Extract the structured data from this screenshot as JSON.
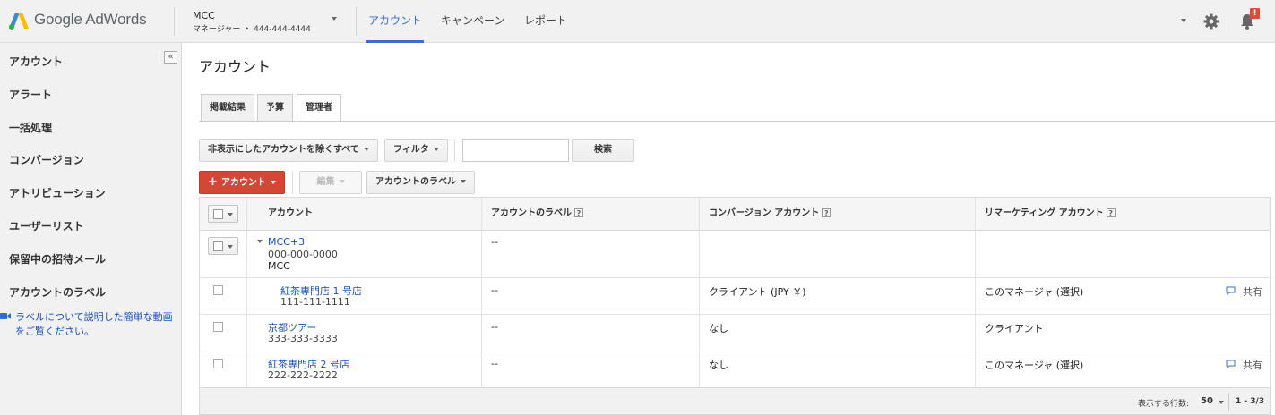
{
  "header": {
    "product": "Google AdWords",
    "account_name": "MCC",
    "account_sub": "マネージャー ・ 444-444-4444",
    "tabs": [
      {
        "label": "アカウント"
      },
      {
        "label": "キャンペーン"
      },
      {
        "label": "レポート"
      }
    ],
    "notification_badge": "!",
    "icons": [
      "adwords-logo-icon",
      "chevron-down-icon",
      "gear-icon",
      "bell-icon"
    ]
  },
  "sidebar": {
    "collapse_label": "«",
    "items": [
      {
        "label": "アカウント"
      },
      {
        "label": "アラート"
      },
      {
        "label": "一括処理"
      },
      {
        "label": "コンバージョン"
      },
      {
        "label": "アトリビューション"
      },
      {
        "label": "ユーザーリスト"
      },
      {
        "label": "保留中の招待メール"
      },
      {
        "label": "アカウントのラベル"
      }
    ],
    "video_link": "ラベルについて説明した簡単な動画をご覧ください。"
  },
  "main": {
    "title": "アカウント",
    "subtabs": [
      {
        "label": "掲載結果"
      },
      {
        "label": "予算"
      },
      {
        "label": "管理者"
      }
    ],
    "toolbar": {
      "filter_hidden": "非表示にしたアカウントを除くすべて",
      "filter": "フィルタ",
      "search_placeholder": "",
      "search_button": "検索",
      "add_account": "アカウント",
      "add_plus": "+",
      "edit": "編集",
      "account_labels": "アカウントのラベル"
    },
    "table": {
      "columns": [
        "アカウント",
        "アカウントのラベル",
        "コンバージョン アカウント",
        "リマーケティング アカウント"
      ],
      "help_glyph": "?",
      "rows": [
        {
          "name": "MCC+3",
          "id": "000-000-0000",
          "extra": "MCC",
          "label": "--",
          "conversion": "",
          "remarketing": "",
          "share": ""
        },
        {
          "name": "紅茶専門店 1 号店",
          "id": "111-111-1111",
          "extra": "",
          "label": "--",
          "conversion": "クライアント (JPY ￥)",
          "remarketing": "このマネージャ (選択)",
          "share": "共有"
        },
        {
          "name": "京都ツアー",
          "id": "333-333-3333",
          "extra": "",
          "label": "--",
          "conversion": "なし",
          "remarketing": "クライアント",
          "share": ""
        },
        {
          "name": "紅茶専門店 2 号店",
          "id": "222-222-2222",
          "extra": "",
          "label": "--",
          "conversion": "なし",
          "remarketing": "このマネージャ (選択)",
          "share": "共有"
        }
      ]
    },
    "footer": {
      "rows_label": "表示する行数:",
      "rows_value": "50",
      "range": "1 - 3/3"
    }
  },
  "colors": {
    "accent_blue": "#3b6fc4",
    "link_blue": "#1a4fb5",
    "add_red": "#d14836",
    "chrome_gray": "#f1f1f1"
  }
}
